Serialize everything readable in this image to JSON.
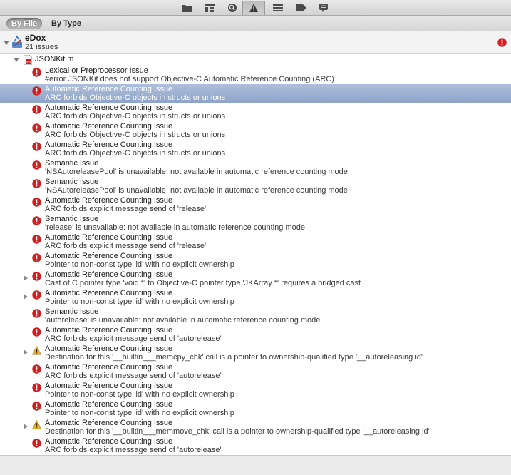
{
  "nav_toolbar": {
    "icons": [
      "folder-icon",
      "hierarchy-icon",
      "search-icon",
      "warning-icon",
      "list-icon",
      "tag-icon",
      "speech-bubble-icon"
    ]
  },
  "scope_bar": {
    "by_file_label": "By File",
    "by_type_label": "By Type"
  },
  "project": {
    "name": "eDox",
    "issue_count": "21 issues"
  },
  "file": {
    "name": "JSONKit.m"
  },
  "issues": [
    {
      "type": "error",
      "title": "Lexical or Preprocessor Issue",
      "message": "#error JSONKit does not support Objective-C Automatic Reference Counting (ARC)",
      "expandable": false,
      "selected": false
    },
    {
      "type": "error",
      "title": "Automatic Reference Counting Issue",
      "message": "ARC forbids Objective-C objects in structs or unions",
      "expandable": false,
      "selected": true
    },
    {
      "type": "error",
      "title": "Automatic Reference Counting Issue",
      "message": "ARC forbids Objective-C objects in structs or unions",
      "expandable": false,
      "selected": false
    },
    {
      "type": "error",
      "title": "Automatic Reference Counting Issue",
      "message": "ARC forbids Objective-C objects in structs or unions",
      "expandable": false,
      "selected": false
    },
    {
      "type": "error",
      "title": "Automatic Reference Counting Issue",
      "message": "ARC forbids Objective-C objects in structs or unions",
      "expandable": false,
      "selected": false
    },
    {
      "type": "error",
      "title": "Semantic Issue",
      "message": "'NSAutoreleasePool' is unavailable: not available in automatic reference counting mode",
      "expandable": false,
      "selected": false
    },
    {
      "type": "error",
      "title": "Semantic Issue",
      "message": "'NSAutoreleasePool' is unavailable: not available in automatic reference counting mode",
      "expandable": false,
      "selected": false
    },
    {
      "type": "error",
      "title": "Automatic Reference Counting Issue",
      "message": "ARC forbids explicit message send of 'release'",
      "expandable": false,
      "selected": false
    },
    {
      "type": "error",
      "title": "Semantic Issue",
      "message": "'release' is unavailable: not available in automatic reference counting mode",
      "expandable": false,
      "selected": false
    },
    {
      "type": "error",
      "title": "Automatic Reference Counting Issue",
      "message": "ARC forbids explicit message send of 'release'",
      "expandable": false,
      "selected": false
    },
    {
      "type": "error",
      "title": "Automatic Reference Counting Issue",
      "message": "Pointer to non-const type 'id' with no explicit ownership",
      "expandable": false,
      "selected": false
    },
    {
      "type": "error",
      "title": "Automatic Reference Counting Issue",
      "message": "Cast of C pointer type 'void *' to Objective-C pointer type 'JKArray *' requires a bridged cast",
      "expandable": true,
      "selected": false
    },
    {
      "type": "error",
      "title": "Automatic Reference Counting Issue",
      "message": "Pointer to non-const type 'id' with no explicit ownership",
      "expandable": true,
      "selected": false
    },
    {
      "type": "error",
      "title": "Semantic Issue",
      "message": "'autorelease' is unavailable: not available in automatic reference counting mode",
      "expandable": false,
      "selected": false
    },
    {
      "type": "error",
      "title": "Automatic Reference Counting Issue",
      "message": "ARC forbids explicit message send of 'autorelease'",
      "expandable": false,
      "selected": false
    },
    {
      "type": "warning",
      "title": "Automatic Reference Counting Issue",
      "message": "Destination for this '__builtin___memcpy_chk' call is a pointer to ownership-qualified type '__autoreleasing id'",
      "expandable": true,
      "selected": false
    },
    {
      "type": "error",
      "title": "Automatic Reference Counting Issue",
      "message": "ARC forbids explicit message send of 'autorelease'",
      "expandable": false,
      "selected": false
    },
    {
      "type": "error",
      "title": "Automatic Reference Counting Issue",
      "message": "Pointer to non-const type 'id' with no explicit ownership",
      "expandable": false,
      "selected": false
    },
    {
      "type": "error",
      "title": "Automatic Reference Counting Issue",
      "message": "Pointer to non-const type 'id' with no explicit ownership",
      "expandable": false,
      "selected": false
    },
    {
      "type": "warning",
      "title": "Automatic Reference Counting Issue",
      "message": "Destination for this '__builtin___memmove_chk' call is a pointer to ownership-qualified type '__autoreleasing id'",
      "expandable": true,
      "selected": false
    },
    {
      "type": "error",
      "title": "Automatic Reference Counting Issue",
      "message": "ARC forbids explicit message send of 'autorelease'",
      "expandable": false,
      "selected": false
    }
  ],
  "colors": {
    "error": "#d21e1e",
    "warning": "#e8b52a",
    "selection": "#8ea4c9"
  }
}
